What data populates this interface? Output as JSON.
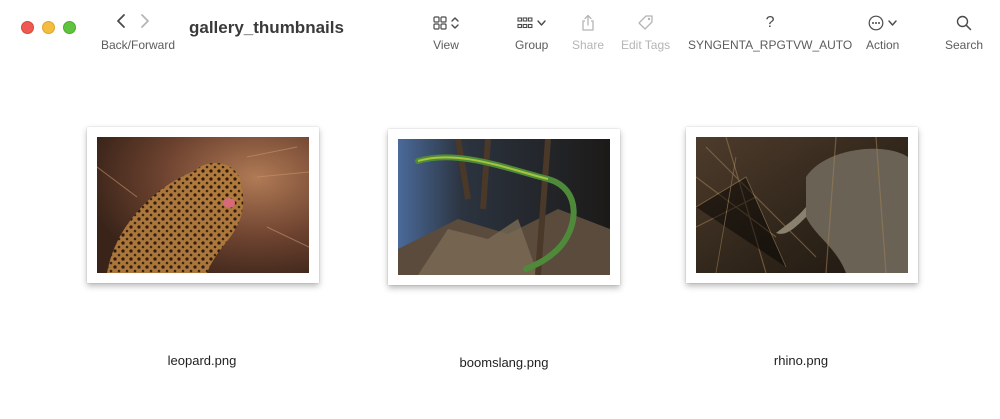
{
  "window": {
    "title": "gallery_thumbnails"
  },
  "toolbar": {
    "nav_label": "Back/Forward",
    "view_label": "View",
    "group_label": "Group",
    "share_label": "Share",
    "edit_tags_label": "Edit Tags",
    "custom_item_label": "SYNGENTA_RPGTVW_AUTO",
    "custom_item_icon": "?",
    "action_label": "Action",
    "search_label": "Search"
  },
  "files": [
    {
      "name": "leopard.png",
      "icon": "leopard-photo"
    },
    {
      "name": "boomslang.png",
      "icon": "snake-photo"
    },
    {
      "name": "rhino.png",
      "icon": "rhino-photo"
    }
  ],
  "colors": {
    "close": "#ee5a52",
    "minimize": "#f4bd3f",
    "maximize": "#5fc33f"
  }
}
